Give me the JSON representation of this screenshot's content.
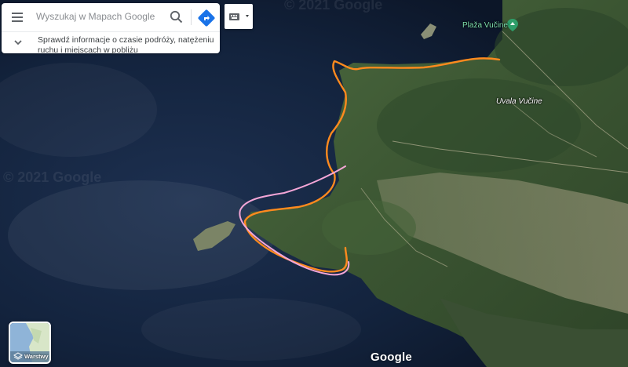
{
  "search": {
    "placeholder": "Wyszukaj w Mapach Google",
    "info_text": "Sprawdź informacje o czasie podróży, natężeniu ruchu i miejscach w pobliżu"
  },
  "map": {
    "type": "satellite",
    "places": {
      "beach": "Plaža Vučine",
      "bay": "Uvala Vučine"
    },
    "watermark": "© 2021 Google",
    "logo": "Google",
    "routes": [
      {
        "color": "#ff8a1e"
      },
      {
        "color": "#f4a6d7"
      }
    ]
  },
  "layers": {
    "label": "Warstwy"
  },
  "icons": [
    "menu-icon",
    "search-icon",
    "directions-icon",
    "chevron-down-icon",
    "keyboard-icon",
    "layers-icon",
    "map-pin-icon"
  ],
  "colors": {
    "water": "#0f1d33",
    "land": "#3d5a33",
    "directions": "#1a73e8"
  }
}
